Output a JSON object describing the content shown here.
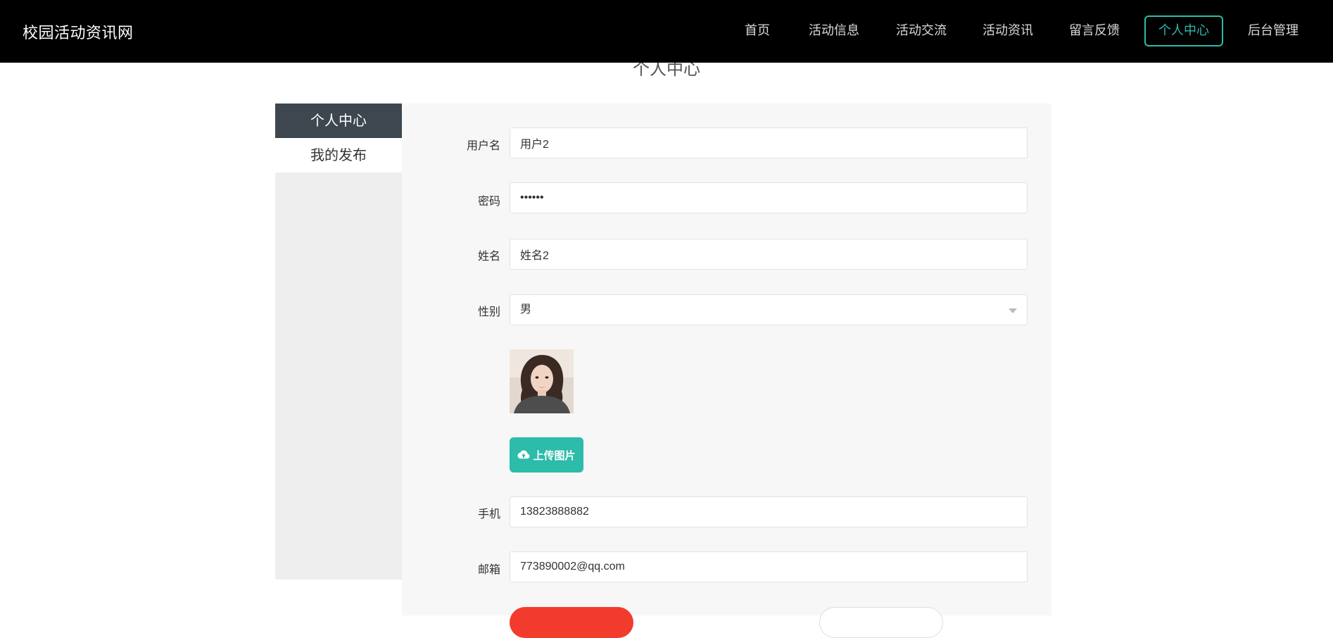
{
  "brand": "校园活动资讯网",
  "nav": {
    "items": [
      "首页",
      "活动信息",
      "活动交流",
      "活动资讯",
      "留言反馈",
      "个人中心",
      "后台管理"
    ],
    "active_label": "个人中心"
  },
  "page_title": "个人中心",
  "sidebar": {
    "items": [
      "个人中心",
      "我的发布"
    ]
  },
  "form": {
    "username": {
      "label": "用户名",
      "value": "用户2"
    },
    "password": {
      "label": "密码",
      "value": "••••••"
    },
    "name": {
      "label": "姓名",
      "value": "姓名2"
    },
    "gender": {
      "label": "性别",
      "value": "男"
    },
    "upload_label": "上传图片",
    "phone": {
      "label": "手机",
      "value": "13823888882"
    },
    "email": {
      "label": "邮箱",
      "value": "773890002@qq.com"
    }
  },
  "colors": {
    "accent": "#2dbbaa",
    "danger": "#f23b2c",
    "topbar": "#000000",
    "sidebar_active": "#3e4750"
  },
  "icons": {
    "upload": "cloud-upload-icon",
    "select": "chevron-down-icon"
  }
}
